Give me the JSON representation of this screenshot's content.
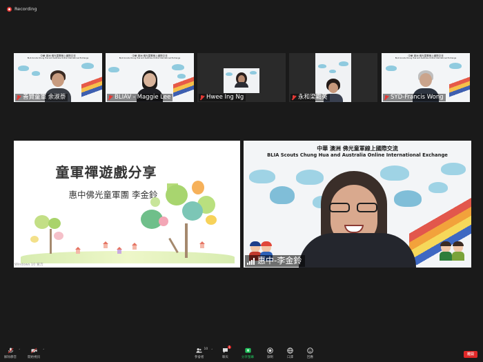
{
  "recording": {
    "label": "Recording"
  },
  "participants": [
    {
      "name": "善賢童軍 余淑萘",
      "muted": true
    },
    {
      "name": "BLIAV - Maggie Lee",
      "muted": true
    },
    {
      "name": "Hwee Ing Ng",
      "muted": true
    },
    {
      "name": "永和梁霸英",
      "muted": true
    },
    {
      "name": "SYD-Francis Wong",
      "muted": true
    }
  ],
  "thumb_header": {
    "line1": "中華 澳洲 佛光童軍線上國際交流",
    "line2": "BLIA Scouts Chung Hua and Australia Online International Exchange"
  },
  "slide": {
    "title": "童軍禪遊戲分享",
    "subtitle": "惠中佛光童軍團 李金鈴",
    "watermark": "Windows 10 官方"
  },
  "speaker": {
    "header_line1": "中華 澳洲 佛光童軍線上國際交流",
    "header_line2": "BLIA Scouts Chung Hua and Australia Online International Exchange",
    "name": "惠中-李金鈴"
  },
  "toolbar": {
    "mute": "解除靜音",
    "video": "開始視訊",
    "participants": "參會者",
    "participants_count": "10",
    "chat": "聊天",
    "chat_badge": "1",
    "share": "分享螢幕",
    "record": "錄制",
    "captions": "口譯",
    "reactions": "回應",
    "end": "離開"
  },
  "colors": {
    "accent_green": "#22c55e",
    "end_red": "#e02828",
    "mute_red": "#e53935"
  }
}
